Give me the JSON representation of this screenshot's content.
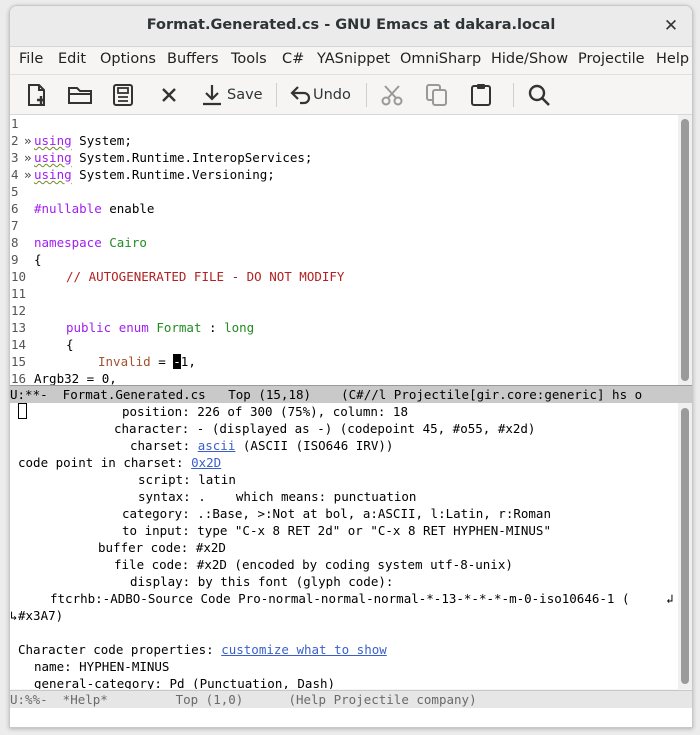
{
  "window": {
    "title": "Format.Generated.cs - GNU Emacs at dakara.local",
    "close_glyph": "✕"
  },
  "menubar": [
    "File",
    "Edit",
    "Options",
    "Buffers",
    "Tools",
    "C#",
    "YASnippet",
    "OmniSharp",
    "Hide/Show",
    "Projectile",
    "Help"
  ],
  "toolbar": {
    "new_icon": "new-file-icon",
    "open_icon": "open-folder-icon",
    "save_doc_icon": "save-document-icon",
    "close_icon": "close-icon",
    "save_label": "Save",
    "undo_label": "Undo",
    "cut_icon": "cut-icon",
    "copy_icon": "copy-icon",
    "paste_icon": "paste-icon",
    "search_icon": "search-icon"
  },
  "code": {
    "line_numbers": [
      "1",
      "2",
      "3",
      "4",
      "5",
      "6",
      "7",
      "8",
      "9",
      "10",
      "11",
      "12",
      "13",
      "14",
      "15",
      "16"
    ],
    "l2": {
      "kw": "using",
      "rest": " System;"
    },
    "l3": {
      "kw": "using",
      "rest": " System.Runtime.InteropServices;"
    },
    "l4": {
      "kw": "using",
      "rest": " System.Runtime.Versioning;"
    },
    "l6": {
      "kw": "#nullable",
      "rest": " enable"
    },
    "l8": {
      "kw": "namespace",
      "name": "Cairo"
    },
    "l9": "{",
    "l10": "// AUTOGENERATED FILE - DO NOT MODIFY",
    "l13": {
      "kw1": "public",
      "kw2": "enum",
      "name": "Format",
      "sep": " : ",
      "type": "long"
    },
    "l14": "{",
    "l15": {
      "var": "Invalid",
      "eq": " = ",
      "cursor_char": "-",
      "rest": "1,"
    },
    "l16": "Argb32 = 0,",
    "fringe_marker": "»"
  },
  "modeline_top": "U:**-  Format.Generated.cs   Top (15,18)    (C#//l Projectile[gir.core:generic] hs o",
  "help": {
    "position": "226 of 300 (75%), column: 18",
    "character_pre": "- (displayed as -) (codepoint 45, #o55, #x2d)",
    "charset_link": "ascii",
    "charset_rest": " (ASCII (ISO646 IRV))",
    "code_point_link": "0x2D",
    "script": "latin",
    "syntax": ".    which means: punctuation",
    "category": ".:Base, >:Not at bol, a:ASCII, l:Latin, r:Roman",
    "to_input": "type \"C-x 8 RET 2d\" or \"C-x 8 RET HYPHEN-MINUS\"",
    "buffer_code": "#x2D",
    "file_code": "#x2D (encoded by coding system utf-8-unix)",
    "display": "by this font (glyph code):",
    "font_line": "ftcrhb:-ADBO-Source Code Pro-normal-normal-normal-*-13-*-*-*-m-0-iso10646-1 (",
    "font_cont": "#x3A7)",
    "props_label": "Character code properties: ",
    "props_link": "customize what to show",
    "name": "name: HYPHEN-MINUS",
    "general_category": "general-category: Pd (Punctuation, Dash)",
    "labels": {
      "position": "position: ",
      "character": "character: ",
      "charset": "charset: ",
      "code_point": "code point in charset: ",
      "script": "script: ",
      "syntax": "syntax: ",
      "category": "category: ",
      "to_input": "to input: ",
      "buffer_code": "buffer code: ",
      "file_code": "file code: ",
      "display": "display: "
    }
  },
  "modeline_bottom": "U:%%-  *Help*         Top (1,0)      (Help Projectile company)"
}
